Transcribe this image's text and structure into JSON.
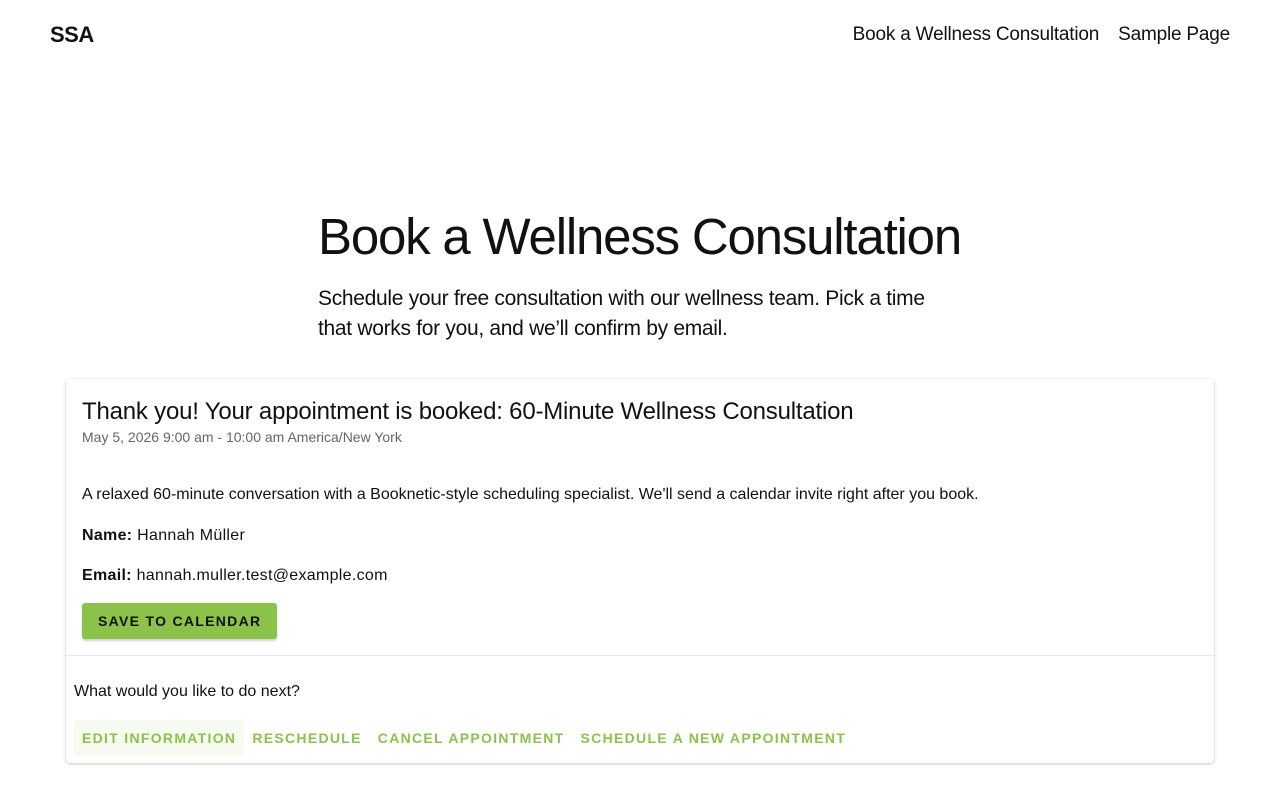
{
  "header": {
    "site_title": "SSA",
    "nav": [
      {
        "label": "Book a Wellness Consultation"
      },
      {
        "label": "Sample Page"
      }
    ]
  },
  "hero": {
    "title": "Book a Wellness Consultation",
    "subtitle": "Schedule your free consultation with our wellness team. Pick a time that works for you, and we’ll confirm by email."
  },
  "confirmation": {
    "title": "Thank you! Your appointment is booked: 60-Minute Wellness Consultation",
    "datetime": "May 5, 2026 9:00 am - 10:00 am America/New York",
    "description": "A relaxed 60-minute conversation with a Booknetic-style scheduling specialist. We'll send a calendar invite right after you book.",
    "name_label": "Name:",
    "name_value": "Hannah Müller",
    "email_label": "Email:",
    "email_value": "hannah.muller.test@example.com",
    "save_button": "Save to Calendar",
    "next_question": "What would you like to do next?",
    "actions": [
      {
        "label": "Edit Information"
      },
      {
        "label": "Reschedule"
      },
      {
        "label": "Cancel Appointment"
      },
      {
        "label": "Schedule a New Appointment"
      }
    ]
  },
  "colors": {
    "accent": "#8bc34a",
    "text": "#111111",
    "muted": "#666666"
  }
}
